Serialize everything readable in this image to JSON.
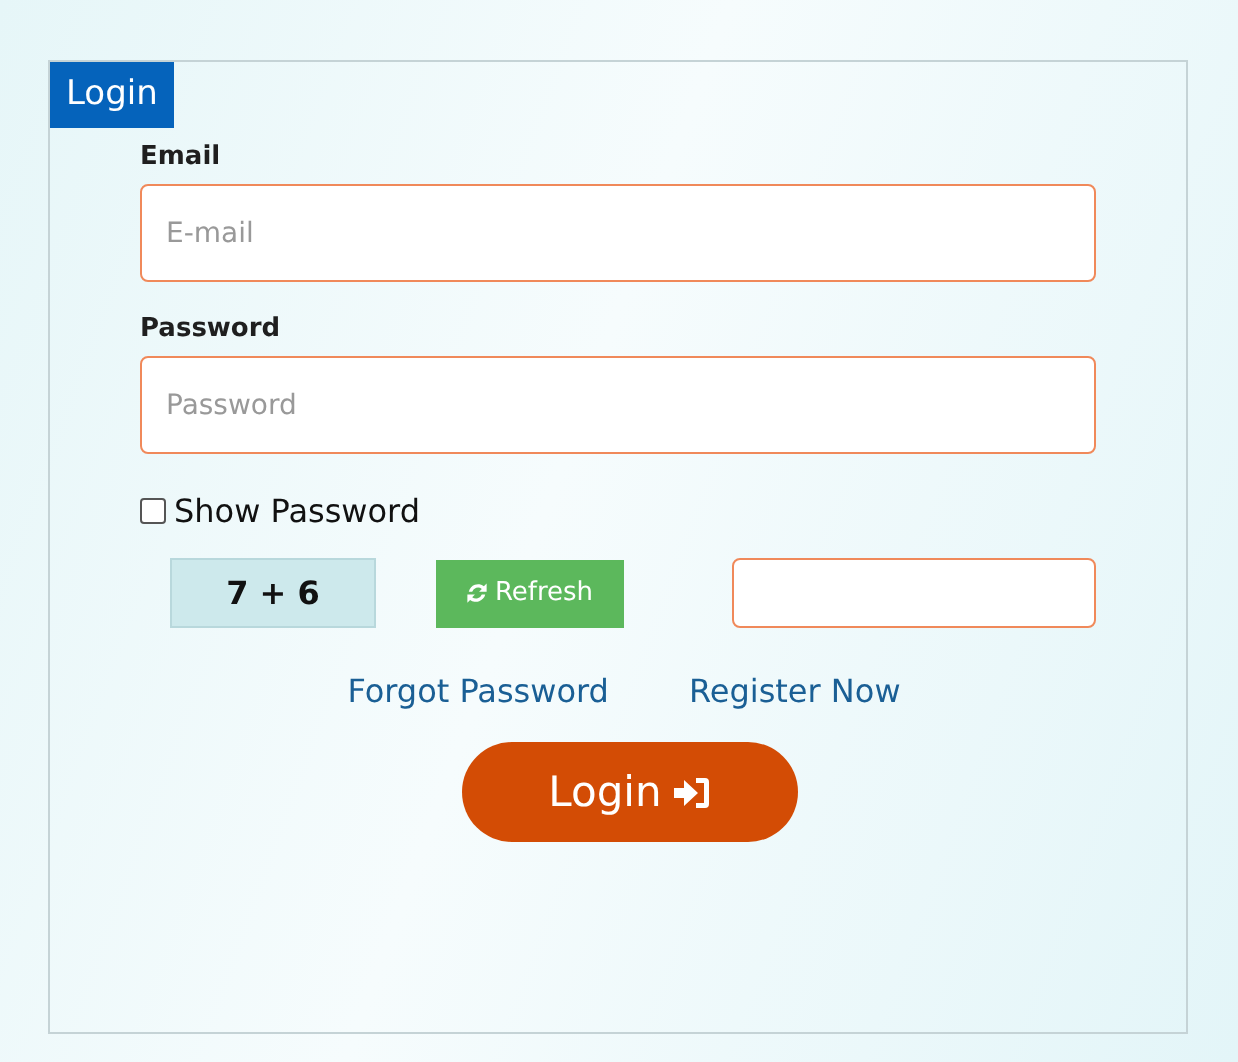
{
  "panel": {
    "title": "Login"
  },
  "fields": [
    {
      "label": "Email",
      "placeholder": "E-mail"
    },
    {
      "label": "Password",
      "placeholder": "Password"
    }
  ],
  "show_password": {
    "label": "Show Password",
    "checked": false
  },
  "captcha": {
    "question": "7 + 6",
    "refresh": "Refresh"
  },
  "links": [
    "Forgot Password",
    "Register Now"
  ],
  "submit": "Login"
}
